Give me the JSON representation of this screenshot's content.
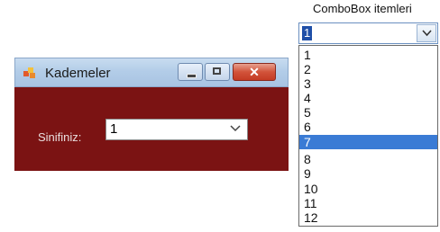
{
  "window": {
    "title": "Kademeler",
    "form": {
      "label": "Sinifiniz:",
      "combo_value": "1"
    }
  },
  "combobox_demo": {
    "caption": "ComboBox itemleri",
    "current_value": "1",
    "items": [
      "1",
      "2",
      "3",
      "4",
      "5",
      "6",
      "7",
      "8",
      "9",
      "10",
      "11",
      "12"
    ],
    "selected_item": "7"
  },
  "colors": {
    "form_background": "#7b1313",
    "title_bar": "#b3cde8",
    "close_button": "#c43b24",
    "selection_highlight": "#3a7bd5"
  },
  "icons": [
    "app-icon",
    "minimize-icon",
    "maximize-icon",
    "close-icon",
    "chevron-down-icon"
  ]
}
